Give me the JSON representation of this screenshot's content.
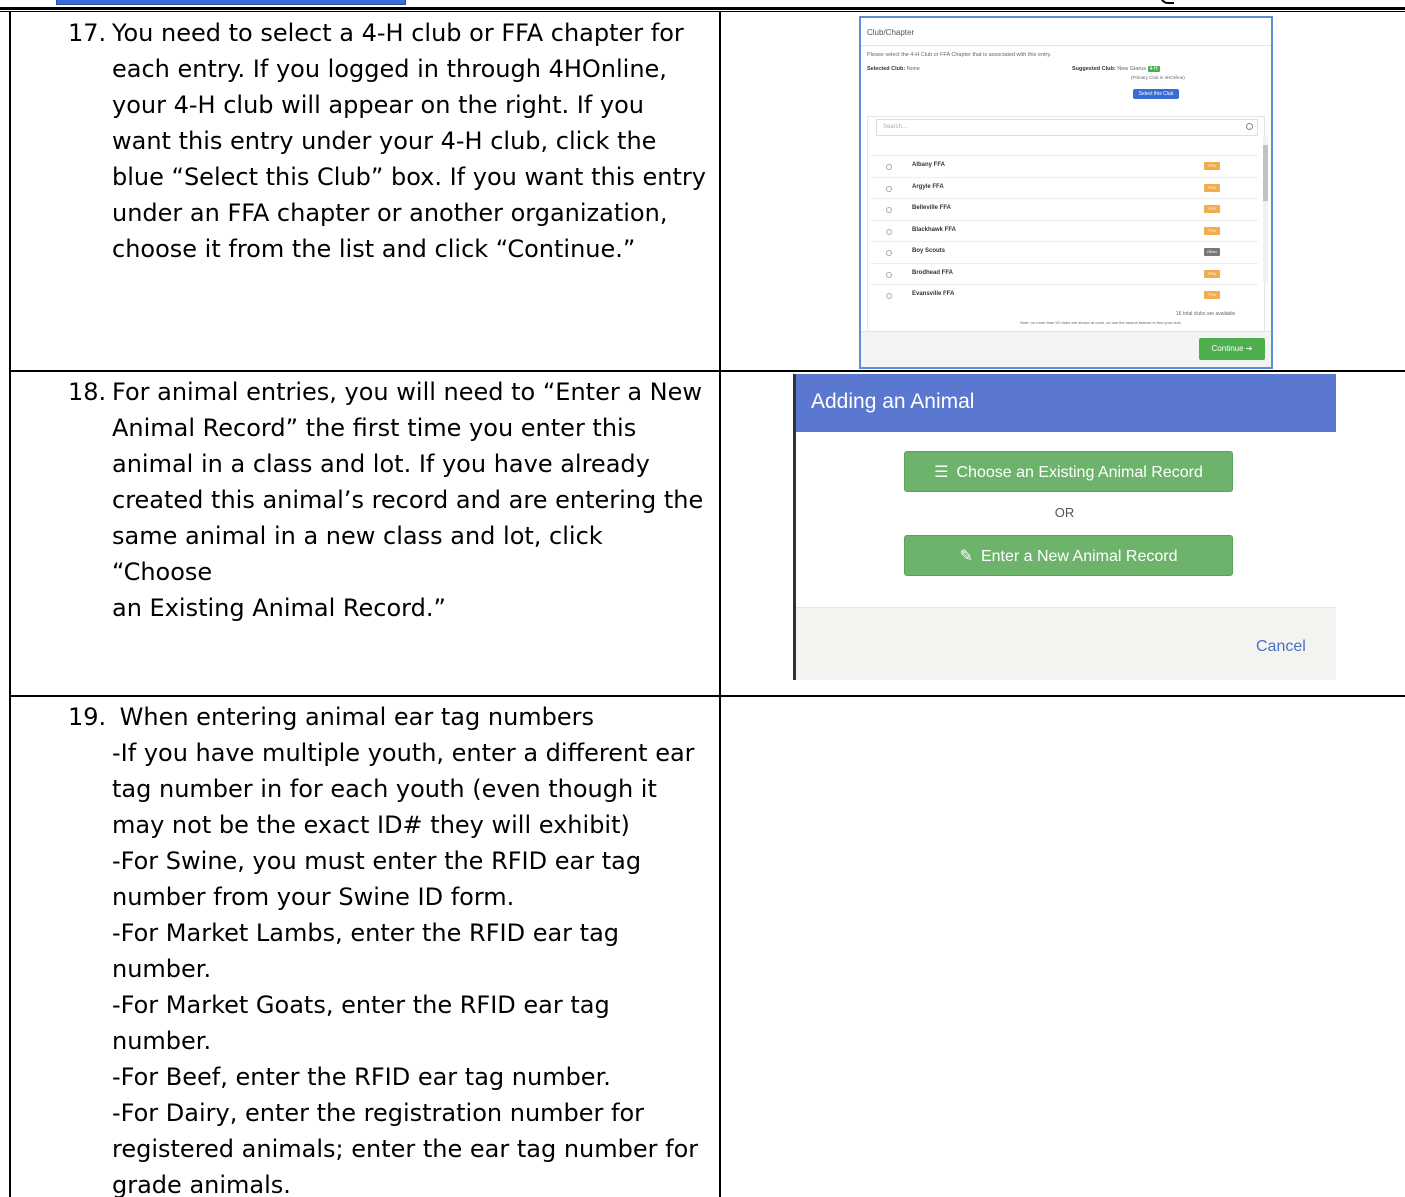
{
  "step17": {
    "number": "17.",
    "lines": [
      "You need to select a 4-H club or FFA chapter for",
      "each entry. If you logged in through 4HOnline,",
      "your 4-H club will appear on the right. If you",
      "want this entry under your 4-H club, click the",
      "blue “Select this Club” box. If you want this entry",
      "under an FFA chapter or another organization,",
      "choose it from the list and click “Continue.”"
    ]
  },
  "step18": {
    "number": "18.",
    "lines": [
      "For animal entries, you will need to “Enter a New",
      "Animal Record” the first time you enter this",
      "animal in a class and lot. If you have already",
      "created this animal’s record and are entering the",
      "same animal in a new class and lot, click “Choose",
      "an Existing Animal Record.”"
    ]
  },
  "step19": {
    "number": "19.",
    "lines": [
      " When entering animal ear tag numbers",
      "-If you have multiple youth, enter a different ear",
      "tag number in for each youth (even though it",
      "may not be the exact ID# they will exhibit)",
      "-For Swine, you must enter the RFID ear tag",
      "number from your Swine ID form.",
      "-For Market Lambs, enter the RFID ear tag",
      "number.",
      "-For Market Goats, enter the RFID ear tag",
      "number.",
      "-For Beef, enter the RFID ear tag number.",
      "-For Dairy, enter the registration number for",
      "registered animals; enter the ear tag number for",
      "grade animals."
    ]
  },
  "club_modal": {
    "title": "Club/Chapter",
    "instruction": "Please select the 4-H Club or FFA Chapter that is associated with this entry.",
    "selected_label": "Selected Club:",
    "selected_value": "None",
    "suggested_label": "Suggested Club:",
    "suggested_value": "New Glarus",
    "suggested_badge": "4-H",
    "suggested_note": "(Primary Club in 4HOnline)",
    "select_button": "Select this Club",
    "search_placeholder": "Search...",
    "clubs": [
      {
        "name": "Albany FFA",
        "badge": "FFA",
        "badge_color": "#f0ad4e"
      },
      {
        "name": "Argyle FFA",
        "badge": "FFA",
        "badge_color": "#f0ad4e"
      },
      {
        "name": "Belleville FFA",
        "badge": "FFA",
        "badge_color": "#f0ad4e"
      },
      {
        "name": "Blackhawk FFA",
        "badge": "FFA",
        "badge_color": "#f0ad4e"
      },
      {
        "name": "Boy Scouts",
        "badge": "Other",
        "badge_color": "#777777"
      },
      {
        "name": "Brodhead FFA",
        "badge": "FFA",
        "badge_color": "#f0ad4e"
      },
      {
        "name": "Evansville FFA",
        "badge": "FFA",
        "badge_color": "#f0ad4e"
      }
    ],
    "total_note": "16 total clubs are available",
    "limit_note": "Note: no more than 50 clubs are shown at once, so use the search feature to find your club.",
    "continue_button": "Continue"
  },
  "animal_modal": {
    "title": "Adding an Animal",
    "existing_button": "Choose an Existing Animal Record",
    "or_text": "OR",
    "new_button": "Enter a New Animal Record",
    "cancel": "Cancel",
    "header_color": "#5b78d1",
    "button_color": "#6db36c"
  }
}
